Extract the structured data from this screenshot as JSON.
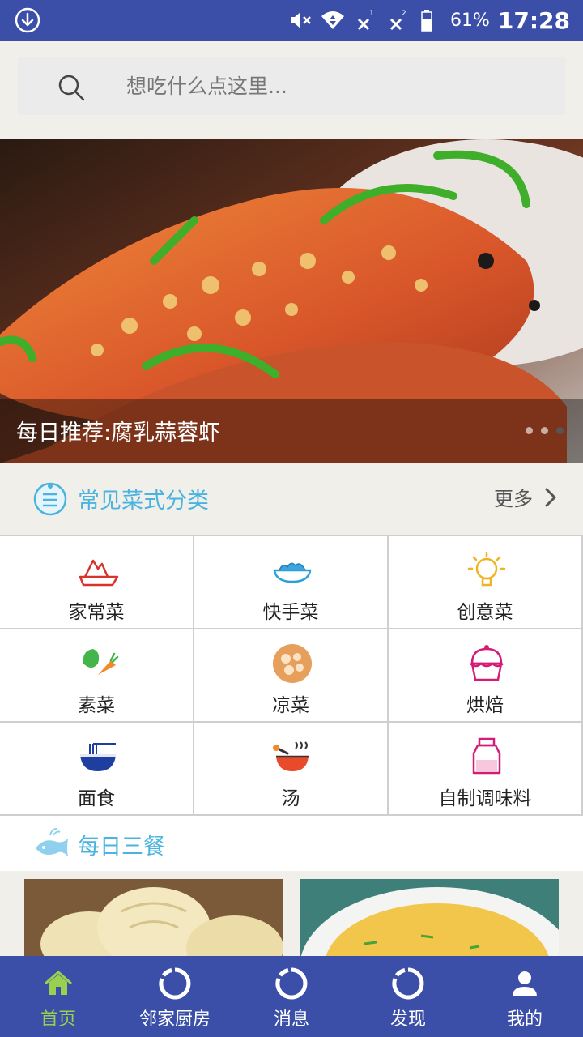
{
  "status_bar": {
    "battery_pct": "61%",
    "time": "17:28",
    "sim1": "1",
    "sim2": "2"
  },
  "search": {
    "placeholder": "想吃什么点这里..."
  },
  "banner": {
    "caption": "每日推荐:腐乳蒜蓉虾",
    "dots_total": 3,
    "active_dot": 3
  },
  "categories": {
    "title": "常见菜式分类",
    "more": "更多",
    "items": [
      {
        "label": "家常菜",
        "icon": "home-dish-icon"
      },
      {
        "label": "快手菜",
        "icon": "quick-dish-icon"
      },
      {
        "label": "创意菜",
        "icon": "lightbulb-icon"
      },
      {
        "label": "素菜",
        "icon": "vegetable-icon"
      },
      {
        "label": "凉菜",
        "icon": "cold-dish-icon"
      },
      {
        "label": "烘焙",
        "icon": "cupcake-icon"
      },
      {
        "label": "面食",
        "icon": "noodle-bowl-icon"
      },
      {
        "label": "汤",
        "icon": "soup-icon"
      },
      {
        "label": "自制调味料",
        "icon": "seasoning-jar-icon"
      }
    ]
  },
  "daily": {
    "title": "每日三餐"
  },
  "bottom_nav": {
    "items": [
      {
        "label": "首页",
        "active": true
      },
      {
        "label": "邻家厨房",
        "active": false
      },
      {
        "label": "消息",
        "active": false
      },
      {
        "label": "发现",
        "active": false
      },
      {
        "label": "我的",
        "active": false
      }
    ]
  },
  "colors": {
    "brand_blue": "#3b4fa8",
    "accent_cyan": "#4bb3e0",
    "active_green": "#9ad04f"
  }
}
